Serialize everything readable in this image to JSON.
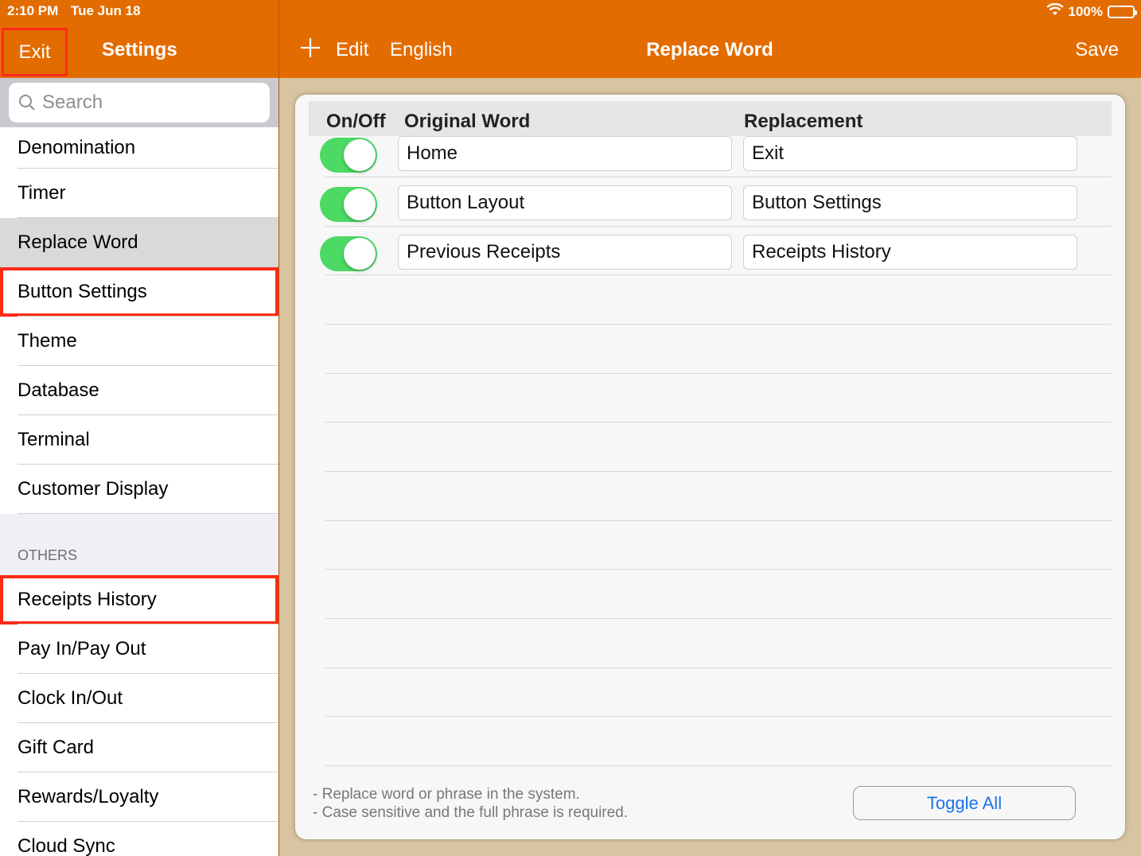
{
  "status": {
    "time": "2:10 PM",
    "date": "Tue Jun 18",
    "battery": "100%"
  },
  "nav": {
    "exit": "Exit",
    "settings": "Settings",
    "edit": "Edit",
    "language": "English",
    "title": "Replace Word",
    "save": "Save"
  },
  "sidebar": {
    "search_placeholder": "Search",
    "items": [
      "Denomination",
      "Timer",
      "Replace Word",
      "Button Settings",
      "Theme",
      "Database",
      "Terminal",
      "Customer Display"
    ],
    "section_header": "OTHERS",
    "others": [
      "Receipts History",
      "Pay In/Pay Out",
      "Clock In/Out",
      "Gift Card",
      "Rewards/Loyalty",
      "Cloud Sync"
    ]
  },
  "table": {
    "headers": {
      "onoff": "On/Off",
      "original": "Original Word",
      "replacement": "Replacement"
    },
    "rows": [
      {
        "on": true,
        "original": "Home",
        "replacement": "Exit"
      },
      {
        "on": true,
        "original": "Button Layout",
        "replacement": "Button Settings"
      },
      {
        "on": true,
        "original": "Previous Receipts",
        "replacement": "Receipts History"
      }
    ]
  },
  "notes": [
    "- Replace word or phrase in the system.",
    "- Case sensitive and the full phrase is required."
  ],
  "toggle_all": "Toggle All"
}
